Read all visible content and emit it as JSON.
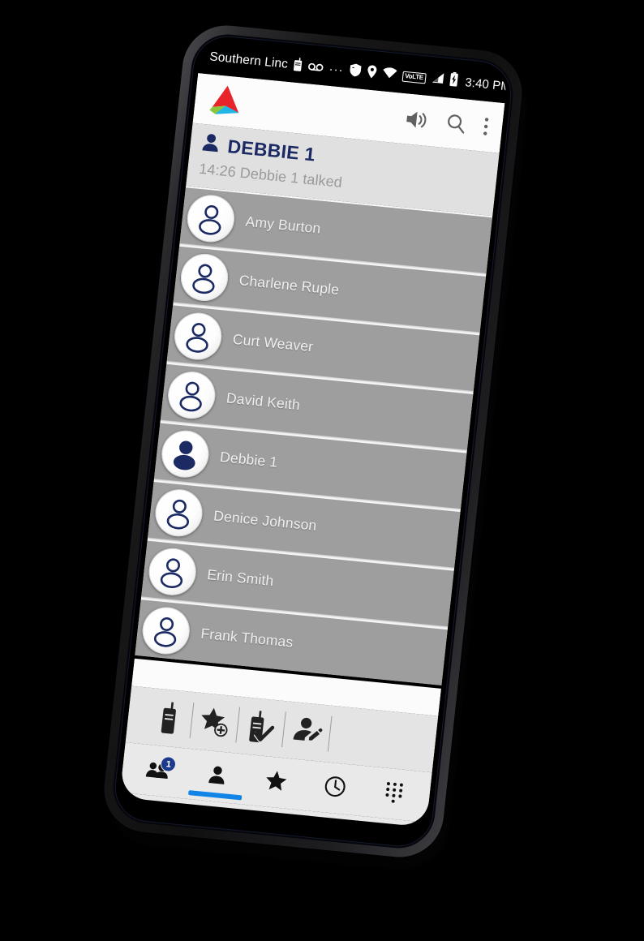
{
  "device": {
    "frame": "smartphone",
    "orientation": "portrait-tilted"
  },
  "statusbar": {
    "carrier": "Southern Linc",
    "icons": [
      "ptt-radio-icon",
      "voicemail-icon",
      "overflow-dots-icon",
      "shield-icon",
      "location-pin-icon",
      "wifi-icon",
      "volte-icon",
      "signal-bars-icon",
      "battery-charging-icon"
    ],
    "volte_label": "VoLTE",
    "overflow_dots": "···",
    "time": "3:40 PM"
  },
  "appbar": {
    "logo_name": "southern-linc-logo",
    "logo_colors": {
      "red": "#e8232a",
      "cyan": "#22b5e8",
      "green": "#8cc63f",
      "white": "#ffffff"
    },
    "actions": [
      {
        "name": "speaker-volume-icon",
        "label": "Speaker"
      },
      {
        "name": "search-icon",
        "label": "Search"
      },
      {
        "name": "overflow-menu-icon",
        "label": "More options"
      }
    ]
  },
  "talkgroup": {
    "icon": "person-icon",
    "title": "DEBBIE 1",
    "subtitle": "14:26 Debbie 1 talked",
    "title_color": "#1b2a63",
    "subtitle_color": "#9a9a9a",
    "background": "#e0e0e0"
  },
  "contacts": {
    "row_background": "#9e9e9e",
    "items": [
      {
        "name": "Amy Burton",
        "avatar": "outline",
        "active": false
      },
      {
        "name": "Charlene Ruple",
        "avatar": "outline",
        "active": false
      },
      {
        "name": "Curt Weaver",
        "avatar": "outline",
        "active": false
      },
      {
        "name": "David Keith",
        "avatar": "outline",
        "active": false
      },
      {
        "name": "Debbie 1",
        "avatar": "filled",
        "active": true
      },
      {
        "name": "Denice Johnson",
        "avatar": "outline",
        "active": false
      },
      {
        "name": "Erin Smith",
        "avatar": "outline",
        "active": false
      },
      {
        "name": "Frank Thomas",
        "avatar": "outline",
        "active": false
      }
    ]
  },
  "actionbar": {
    "background": "#e4e4e4",
    "buttons": [
      {
        "name": "ptt-radio-icon",
        "label": "Push to talk"
      },
      {
        "name": "star-add-icon",
        "label": "Add to favorites"
      },
      {
        "name": "radio-check-icon",
        "label": "Confirm call"
      },
      {
        "name": "person-edit-icon",
        "label": "Edit contact"
      }
    ]
  },
  "bottomnav": {
    "background": "#e9e9e9",
    "selected_index": 1,
    "indicator_color": "#1184e8",
    "items": [
      {
        "name": "groups-icon",
        "label": "Groups",
        "badge": "1"
      },
      {
        "name": "contacts-person-icon",
        "label": "Contacts",
        "badge": ""
      },
      {
        "name": "favorites-star-icon",
        "label": "Favorites",
        "badge": ""
      },
      {
        "name": "recents-clock-icon",
        "label": "Recents",
        "badge": ""
      },
      {
        "name": "dialpad-icon",
        "label": "Dialpad",
        "badge": ""
      }
    ]
  }
}
